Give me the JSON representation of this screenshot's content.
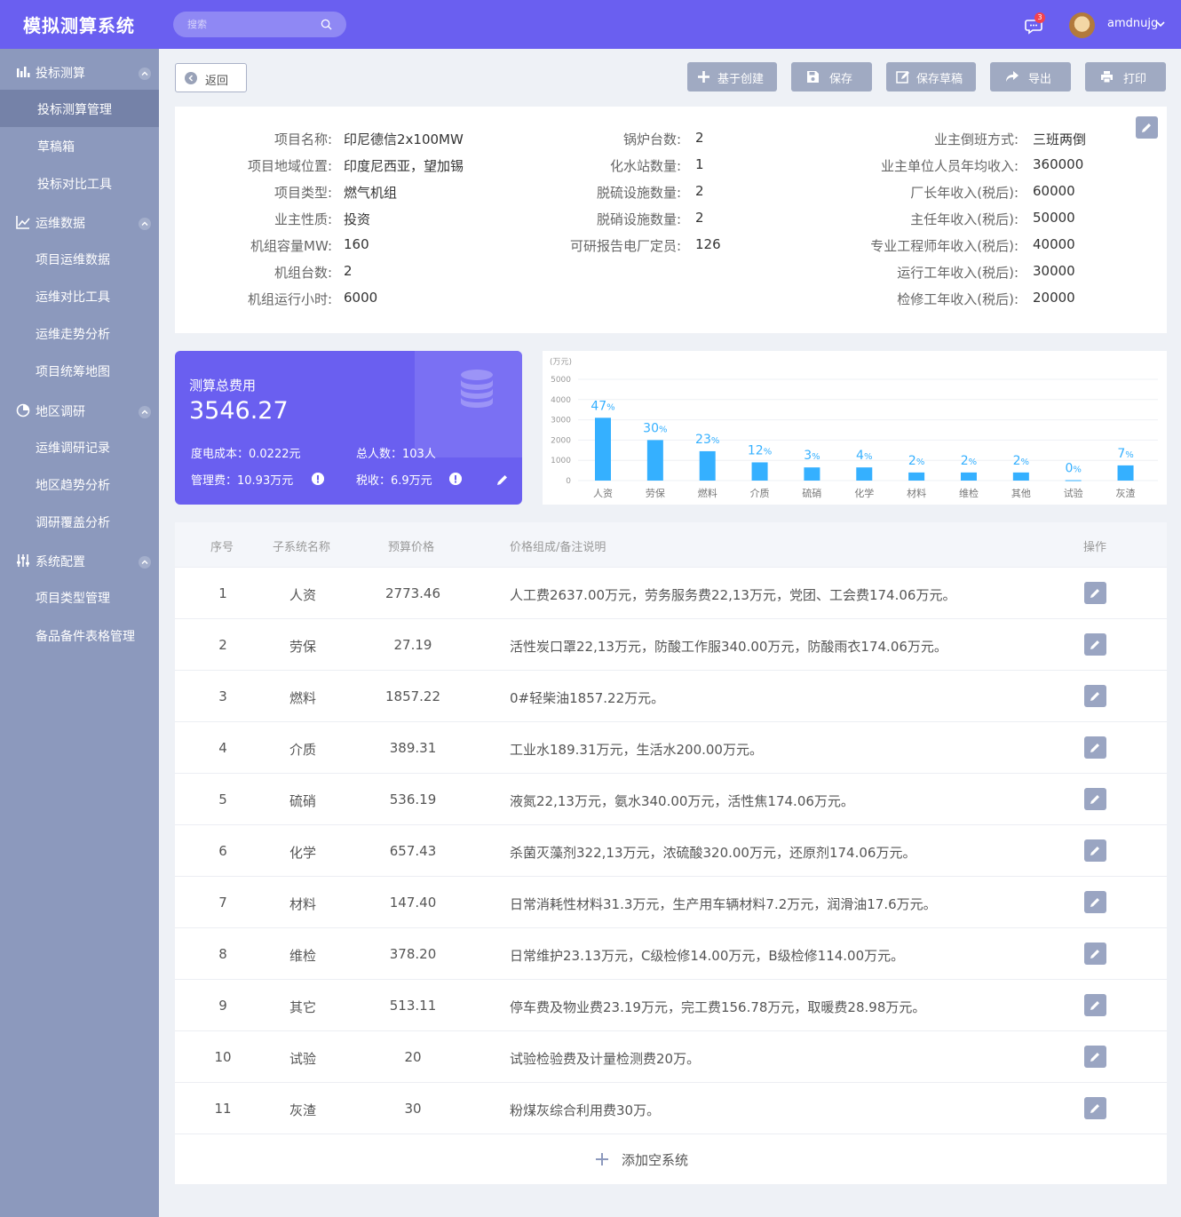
{
  "header": {
    "logo": "模拟测算系统",
    "search_placeholder": "搜索",
    "message_count": "3",
    "username": "amdnujg"
  },
  "sidebar": {
    "groups": [
      {
        "label": "投标测算",
        "icon": "bar-chart-icon",
        "items": [
          "投标测算管理",
          "草稿箱",
          "投标对比工具"
        ]
      },
      {
        "label": "运维数据",
        "icon": "line-chart-icon",
        "items": [
          "项目运维数据",
          "运维对比工具",
          "运维走势分析",
          "项目统筹地图"
        ]
      },
      {
        "label": "地区调研",
        "icon": "pie-chart-icon",
        "items": [
          "运维调研记录",
          "地区趋势分析",
          "调研覆盖分析"
        ]
      },
      {
        "label": "系统配置",
        "icon": "sliders-icon",
        "items": [
          "项目类型管理",
          "备品备件表格管理"
        ]
      }
    ]
  },
  "toolbar": {
    "back": "返回",
    "create_from": "基于创建",
    "save": "保存",
    "save_draft": "保存草稿",
    "export": "导出",
    "print": "打印"
  },
  "info": {
    "col1": [
      {
        "label": "项目名称:",
        "value": "印尼德信2x100MW"
      },
      {
        "label": "项目地域位置:",
        "value": "印度尼西亚，望加锡"
      },
      {
        "label": "项目类型:",
        "value": "燃气机组"
      },
      {
        "label": "业主性质:",
        "value": "投资"
      },
      {
        "label": "机组容量MW:",
        "value": "160"
      },
      {
        "label": "机组台数:",
        "value": "2"
      },
      {
        "label": "机组运行小时:",
        "value": "6000"
      }
    ],
    "col2": [
      {
        "label": "锅炉台数:",
        "value": "2"
      },
      {
        "label": "化水站数量:",
        "value": "1"
      },
      {
        "label": "脱硫设施数量:",
        "value": "2"
      },
      {
        "label": "脱硝设施数量:",
        "value": "2"
      },
      {
        "label": "可研报告电厂定员:",
        "value": "126"
      }
    ],
    "col3": [
      {
        "label": "业主倒班方式:",
        "value": "三班两倒"
      },
      {
        "label": "业主单位人员年均收入:",
        "value": "360000"
      },
      {
        "label": "厂长年收入(税后):",
        "value": "60000"
      },
      {
        "label": "主任年收入(税后):",
        "value": "50000"
      },
      {
        "label": "专业工程师年收入(税后):",
        "value": "40000"
      },
      {
        "label": "运行工年收入(税后):",
        "value": "30000"
      },
      {
        "label": "检修工年收入(税后):",
        "value": "20000"
      }
    ]
  },
  "summary": {
    "title": "测算总费用",
    "total": "3546.27",
    "power_cost": "度电成本：0.0222元",
    "headcount": "总人数：103人",
    "mgmt_fee": "管理费：10.93万元",
    "tax": "税收：6.9万元"
  },
  "chart_data": {
    "type": "bar",
    "unit_label": "(万元)",
    "ylim": [
      0,
      5000
    ],
    "yticks": [
      0,
      1000,
      2000,
      3000,
      4000,
      5000
    ],
    "categories": [
      "人资",
      "劳保",
      "燃料",
      "介质",
      "硫硝",
      "化学",
      "材料",
      "维检",
      "其他",
      "试验",
      "灰渣"
    ],
    "values": [
      3100,
      2000,
      1450,
      900,
      650,
      650,
      400,
      400,
      400,
      20,
      750
    ],
    "percent_labels": [
      "47",
      "30",
      "23",
      "12",
      "3",
      "4",
      "2",
      "2",
      "2",
      "0",
      "7"
    ],
    "percent_sign": "%",
    "bar_color": "#35b0ff",
    "grid": true
  },
  "table": {
    "headers": [
      "序号",
      "子系统名称",
      "预算价格",
      "价格组成/备注说明",
      "操作"
    ],
    "rows": [
      {
        "no": "1",
        "name": "人资",
        "price": "2773.46",
        "note": "人工费2637.00万元，劳务服务费22,13万元，党团、工会费174.06万元。"
      },
      {
        "no": "2",
        "name": "劳保",
        "price": "27.19",
        "note": "活性炭口罩22,13万元，防酸工作服340.00万元，防酸雨衣174.06万元。"
      },
      {
        "no": "3",
        "name": "燃料",
        "price": "1857.22",
        "note": "0#轻柴油1857.22万元。"
      },
      {
        "no": "4",
        "name": "介质",
        "price": "389.31",
        "note": "工业水189.31万元，生活水200.00万元。"
      },
      {
        "no": "5",
        "name": "硫硝",
        "price": "536.19",
        "note": "液氮22,13万元，氨水340.00万元，活性焦174.06万元。"
      },
      {
        "no": "6",
        "name": "化学",
        "price": "657.43",
        "note": "杀菌灭藻剂322,13万元，浓硫酸320.00万元，还原剂174.06万元。"
      },
      {
        "no": "7",
        "name": "材料",
        "price": "147.40",
        "note": "日常消耗性材料31.3万元，生产用车辆材料7.2万元，润滑油17.6万元。"
      },
      {
        "no": "8",
        "name": "维检",
        "price": "378.20",
        "note": "日常维护23.13万元，C级检修14.00万元，B级检修114.00万元。"
      },
      {
        "no": "9",
        "name": "其它",
        "price": "513.11",
        "note": "停车费及物业费23.19万元，完工费156.78万元，取暖费28.98万元。"
      },
      {
        "no": "10",
        "name": "试验",
        "price": "20",
        "note": "试验检验费及计量检测费20万。"
      },
      {
        "no": "11",
        "name": "灰渣",
        "price": "30",
        "note": "粉煤灰综合利用费30万。"
      }
    ],
    "add_label": "添加空系统"
  }
}
